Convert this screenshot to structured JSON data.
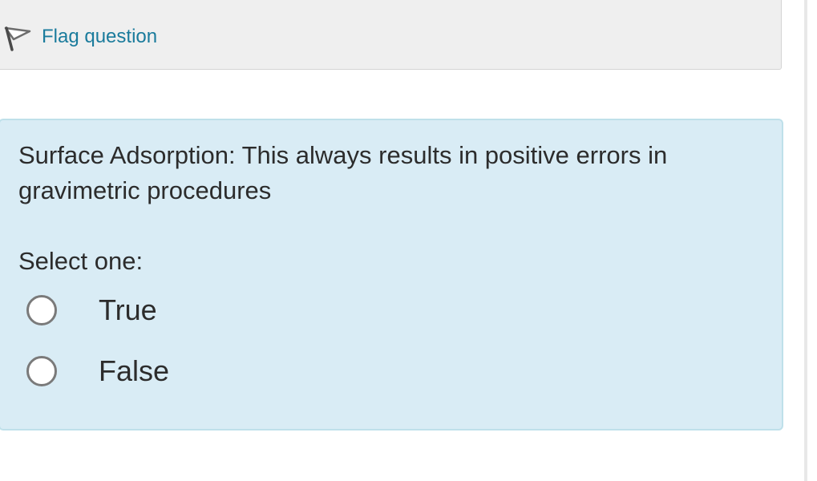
{
  "flag": {
    "label": "Flag question",
    "icon": "flag-icon"
  },
  "question": {
    "text": "Surface Adsorption: This always results in positive errors in gravimetric procedures",
    "prompt": "Select one:",
    "options": [
      {
        "label": "True",
        "selected": false
      },
      {
        "label": "False",
        "selected": false
      }
    ]
  },
  "colors": {
    "link": "#1a7b9c",
    "info_bg": "#efefef",
    "question_bg": "#d9ecf5",
    "question_border": "#bfe0ea",
    "text": "#2c2c2c"
  }
}
